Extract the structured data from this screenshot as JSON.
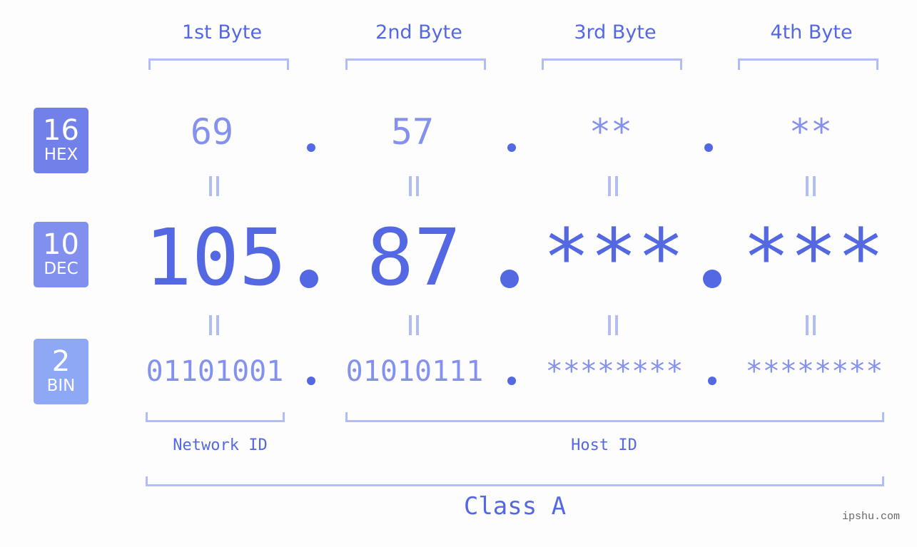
{
  "bytes": {
    "headers": [
      "1st Byte",
      "2nd Byte",
      "3rd Byte",
      "4th Byte"
    ]
  },
  "bases": {
    "hex": {
      "number": "16",
      "label": "HEX",
      "color": "#7280ea"
    },
    "dec": {
      "number": "10",
      "label": "DEC",
      "color": "#8190ee"
    },
    "bin": {
      "number": "2",
      "label": "BIN",
      "color": "#8ea8f6"
    }
  },
  "address": {
    "hex": [
      "69",
      "57",
      "**",
      "**"
    ],
    "dec": [
      "105",
      "87",
      "***",
      "***"
    ],
    "bin": [
      "01101001",
      "01010111",
      "********",
      "********"
    ],
    "separator": "."
  },
  "parts": {
    "network_label": "Network ID",
    "host_label": "Host ID",
    "class_label": "Class A"
  },
  "watermark": "ipshu.com",
  "colors": {
    "primary": "#5468e4",
    "secondary": "#8492ee",
    "bracket": "#b3bdf5",
    "background": "#fcfdfc"
  }
}
